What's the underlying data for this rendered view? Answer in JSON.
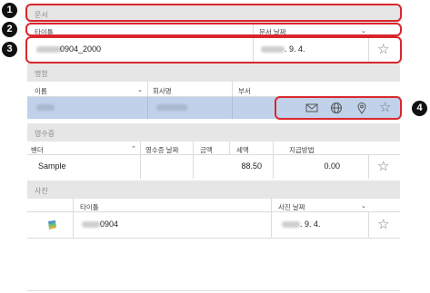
{
  "document": {
    "header": "문서",
    "col_title": "타이틀",
    "col_date": "문서 날짜",
    "title_suffix": "0904_2000",
    "date_suffix": ". 9. 4."
  },
  "business_card": {
    "header": "명함",
    "col_name": "이름",
    "col_company": "회사명",
    "col_department": "부서",
    "actions": [
      "mail-icon",
      "globe-icon",
      "location-pin-icon",
      "star-icon"
    ]
  },
  "receipt": {
    "header": "영수증",
    "col_vendor": "벤더",
    "col_date": "영수증 날짜",
    "col_amount": "금액",
    "col_tax": "세액",
    "col_payment": "지급방법",
    "vendor": "Sample",
    "amount": "88.50",
    "tax": "0.00"
  },
  "photo": {
    "header": "사진",
    "col_title": "타이틀",
    "col_date": "사진 날짜",
    "title_suffix": "0904",
    "date_suffix": ". 9. 4."
  },
  "callouts": [
    "1",
    "2",
    "3",
    "4"
  ],
  "colors": {
    "callout_border": "#d9262c",
    "selected_row": "#bfd2ea",
    "section_header": "#e6e6e6"
  }
}
